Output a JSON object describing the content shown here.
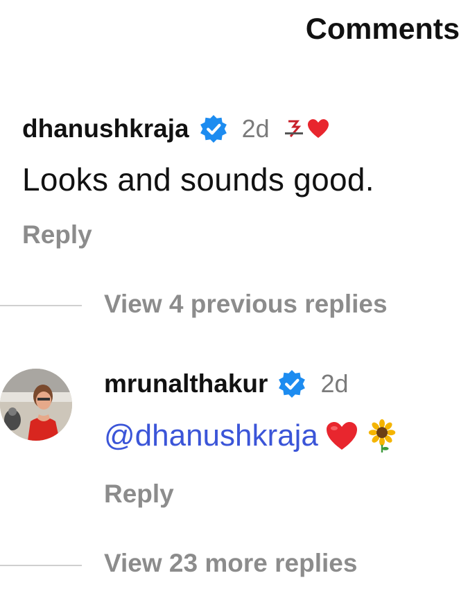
{
  "header": {
    "title": "Comments"
  },
  "comment_1": {
    "username": "dhanushkraja",
    "verified_icon": "verified-badge-icon",
    "time": "2d",
    "badge_icons": [
      "brand-logo-icon",
      "red-heart-icon"
    ],
    "text": "Looks and sounds good.",
    "reply_label": "Reply",
    "view_replies_label": "View 4 previous replies"
  },
  "comment_2": {
    "username": "mrunalthakur",
    "verified_icon": "verified-badge-icon",
    "time": "2d",
    "mention": "@dhanushkraja",
    "emojis": [
      "red-heart-icon",
      "sunflower-icon"
    ],
    "reply_label": "Reply",
    "view_replies_label": "View 23 more replies"
  },
  "colors": {
    "verified_blue": "#1d8cf0",
    "mention_blue": "#3b55d8",
    "heart_red": "#e8262e",
    "muted_gray": "#8c8c8c"
  }
}
